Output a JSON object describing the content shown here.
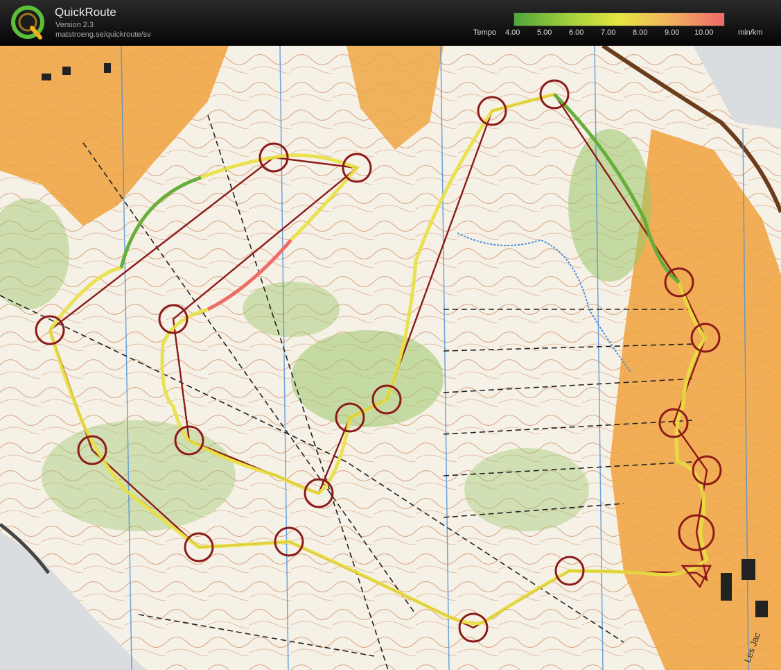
{
  "app": {
    "title": "QuickRoute",
    "version": "Version 2.3",
    "url": "matstroeng.se/quickroute/sv"
  },
  "legend": {
    "label": "Tempo",
    "ticks": [
      "4.00",
      "5.00",
      "6.00",
      "7.00",
      "8.00",
      "9.00",
      "10.00"
    ],
    "unit": "min/km",
    "colors": [
      "#4fa63a",
      "#9fcf3d",
      "#e6e640",
      "#f2b060",
      "#f06a6a"
    ]
  },
  "map": {
    "colors": {
      "paper": "#f6f1e6",
      "open": "#f0a23c",
      "forest": "#9cc66a",
      "contour": "#c0622e",
      "north_line": "#4a90d9",
      "course": "#8b1a1a",
      "route": "#e8e040"
    },
    "place_label": "Les Jac"
  }
}
